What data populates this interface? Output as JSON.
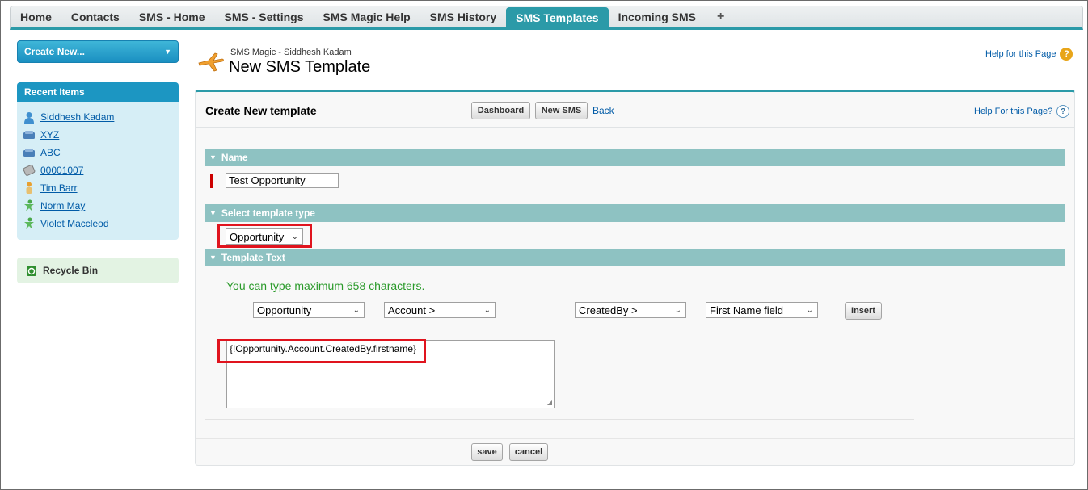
{
  "tabs": [
    {
      "label": "Home",
      "active": false
    },
    {
      "label": "Contacts",
      "active": false
    },
    {
      "label": "SMS - Home",
      "active": false
    },
    {
      "label": "SMS - Settings",
      "active": false
    },
    {
      "label": "SMS Magic Help",
      "active": false
    },
    {
      "label": "SMS History",
      "active": false
    },
    {
      "label": "SMS Templates",
      "active": true
    },
    {
      "label": "Incoming SMS",
      "active": false
    }
  ],
  "tab_plus": "+",
  "sidebar": {
    "create_new": "Create New...",
    "recent_title": "Recent Items",
    "recent_items": [
      {
        "label": "Siddhesh Kadam",
        "icon": "contact-icon"
      },
      {
        "label": "XYZ",
        "icon": "account-icon"
      },
      {
        "label": "ABC",
        "icon": "account-icon"
      },
      {
        "label": "00001007",
        "icon": "case-icon"
      },
      {
        "label": "Tim Barr",
        "icon": "lead-icon"
      },
      {
        "label": "Norm May",
        "icon": "person-star-icon"
      },
      {
        "label": "Violet Maccleod",
        "icon": "person-star-icon"
      }
    ],
    "recycle_bin": "Recycle Bin"
  },
  "header": {
    "subtitle": "SMS Magic - Siddhesh Kadam",
    "title": "New SMS Template",
    "help": "Help for this Page"
  },
  "panel": {
    "title": "Create New template",
    "dashboard_btn": "Dashboard",
    "new_sms_btn": "New SMS",
    "back_link": "Back",
    "help": "Help For this Page?",
    "sections": {
      "name": "Name",
      "template_type": "Select template type",
      "template_text": "Template Text"
    },
    "name_value": "Test Opportunity",
    "template_type_value": "Opportunity",
    "info_text": "You can type maximum 658 characters.",
    "field_selects": [
      "Opportunity",
      "Account >",
      "CreatedBy >",
      "First Name field"
    ],
    "insert_btn": "Insert",
    "template_text_value": "{!Opportunity.Account.CreatedBy.firstname}",
    "save_btn": "save",
    "cancel_btn": "cancel"
  },
  "colors": {
    "accent": "#2b9aa8",
    "section_bar": "#8ec2c2",
    "highlight": "#e0141e",
    "info_text": "#2a9a2a",
    "link": "#015ba7"
  }
}
